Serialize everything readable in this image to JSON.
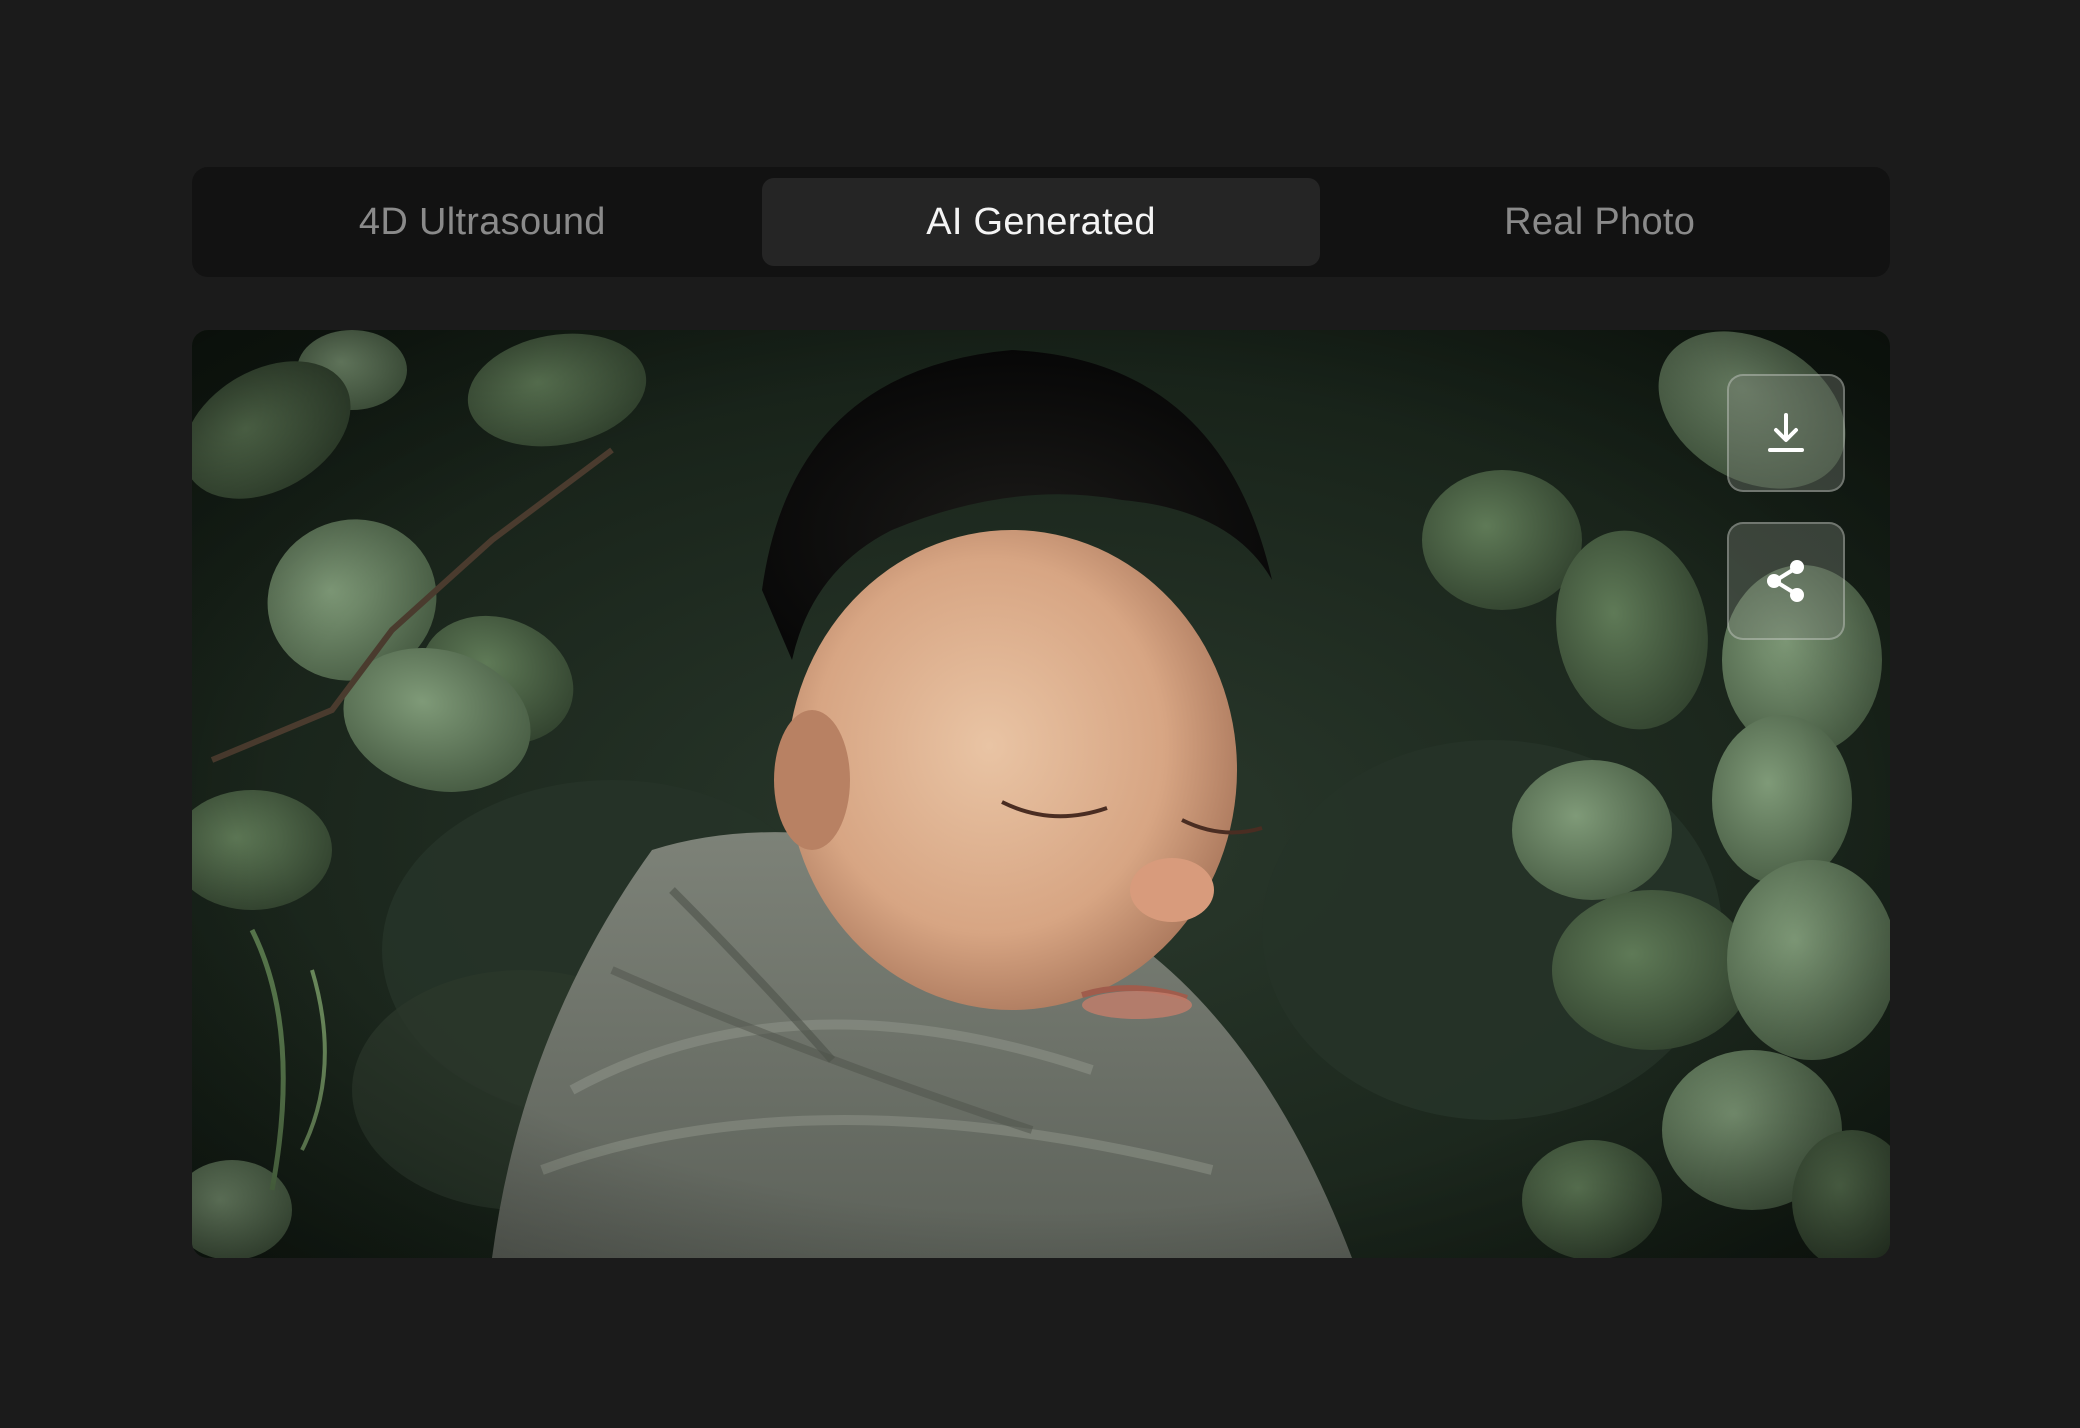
{
  "tabs": [
    {
      "label": "4D Ultrasound",
      "active": false
    },
    {
      "label": "AI Generated",
      "active": true
    },
    {
      "label": "Real Photo",
      "active": false
    }
  ],
  "viewer": {
    "image_subject": "sleeping newborn wrapped in grey knit swaddle among eucalyptus leaves",
    "actions": [
      {
        "icon": "download-icon"
      },
      {
        "icon": "share-icon"
      }
    ]
  },
  "colors": {
    "background": "#1b1b1b",
    "tab_bar": "#121212",
    "tab_active": "#252525",
    "tab_active_text": "#f4f4f4",
    "tab_inactive_text": "#8a8a8a"
  }
}
